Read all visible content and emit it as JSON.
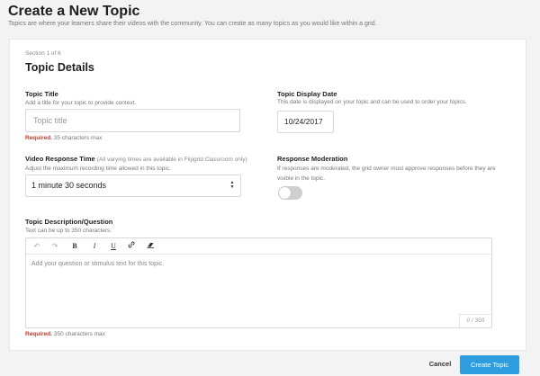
{
  "header": {
    "title": "Create a New Topic",
    "subtitle": "Topics are where your learners share their videos with the community. You can create as many topics as you would like within a grid."
  },
  "section": {
    "label": "Section 1 of 6",
    "title": "Topic Details"
  },
  "topic_title": {
    "label": "Topic Title",
    "help": "Add a title for your topic to provide context.",
    "placeholder": "Topic title",
    "value": "",
    "required_label": "Required.",
    "required_text": "35 characters max"
  },
  "display_date": {
    "label": "Topic Display Date",
    "help": "This date is displayed on your topic and can be used to order your topics.",
    "value": "10/24/2017"
  },
  "response_time": {
    "label": "Video Response Time",
    "note": "(All varying times are available in Flipgrid Classroom only)",
    "help": "Adjust the maximum recording time allowed in this topic.",
    "selected": "1 minute 30 seconds"
  },
  "moderation": {
    "label": "Response Moderation",
    "help_line1": "If responses are moderated, the grid owner must approve responses before they are",
    "help_line2": "visible in the topic.",
    "enabled": false
  },
  "description": {
    "label": "Topic Description/Question",
    "help": "Text can be up to 350 characters.",
    "placeholder": "Add your question or stimulus text for this topic.",
    "counter": "0 / 350",
    "required_label": "Required.",
    "required_text": "350 characters max",
    "toolbar_icons": [
      "undo-icon",
      "redo-icon",
      "bold-icon",
      "italic-icon",
      "underline-icon",
      "link-icon",
      "clear-format-icon"
    ]
  },
  "footer": {
    "cancel_label": "Cancel",
    "create_label": "Create Topic"
  },
  "colors": {
    "accent": "#2e9de0",
    "required": "#c0392b",
    "background": "#f3f3f3"
  }
}
